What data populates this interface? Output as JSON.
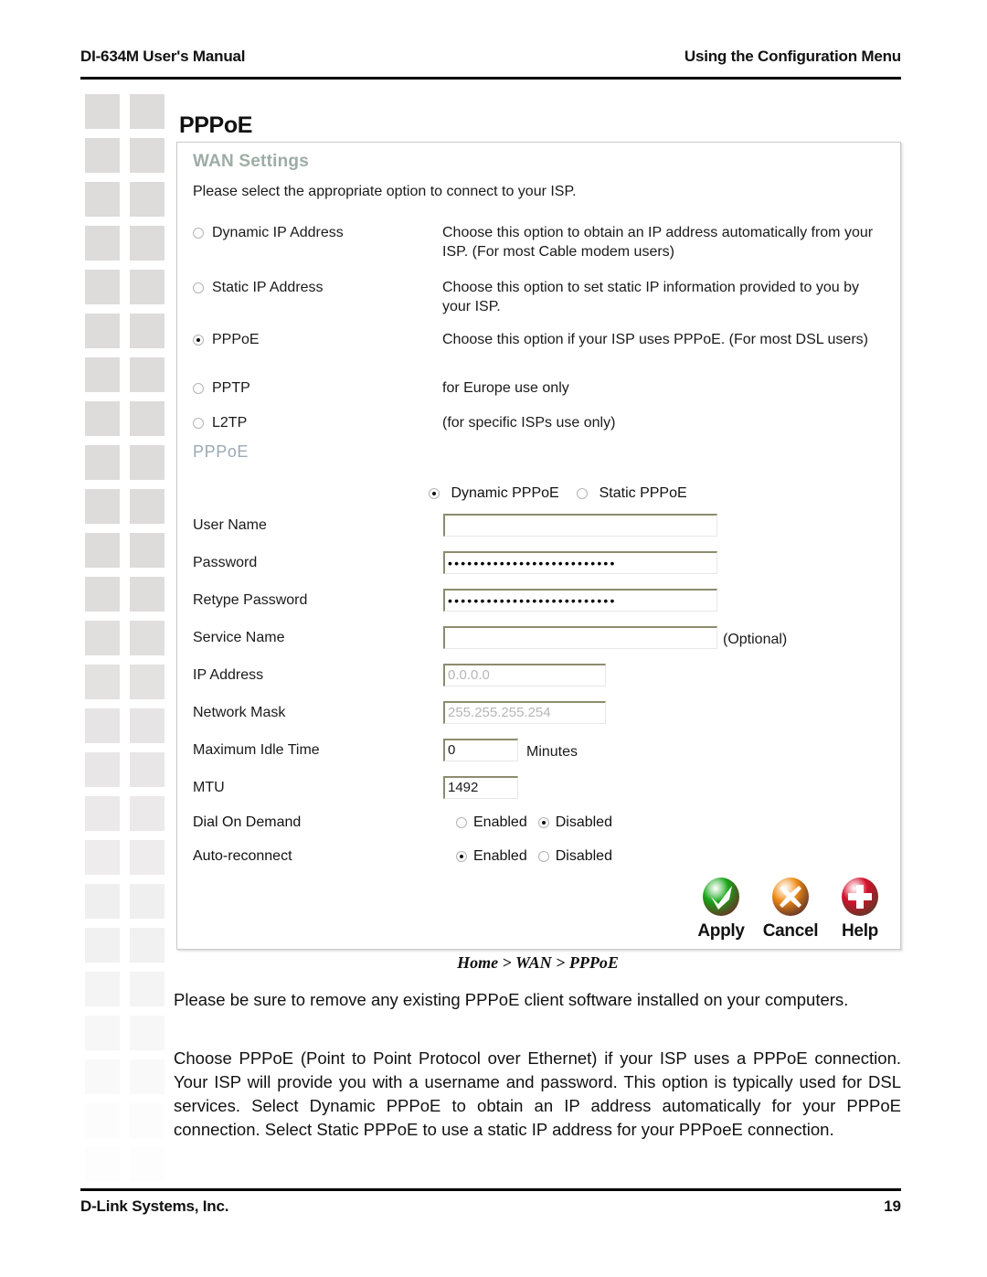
{
  "header": {
    "left": "DI-634M User's Manual",
    "right": "Using the Configuration Menu"
  },
  "section_title": "PPPoE",
  "panel": {
    "wan_heading": "WAN Settings",
    "intro": "Please select the appropriate option to connect to your ISP.",
    "connection_types": [
      {
        "label": "Dynamic IP Address",
        "selected": false,
        "description": "Choose this option to obtain an IP address automatically from your ISP. (For most Cable modem users)"
      },
      {
        "label": "Static IP Address",
        "selected": false,
        "description": "Choose this option to set static IP information provided to you by your ISP."
      },
      {
        "label": "PPPoE",
        "selected": true,
        "description": "Choose this option if your ISP uses PPPoE. (For most DSL users)"
      },
      {
        "label": "PPTP",
        "selected": false,
        "description": "for Europe use only"
      },
      {
        "label": "L2TP",
        "selected": false,
        "description": "(for specific ISPs use only)"
      }
    ],
    "pppoe_heading": "PPPoE",
    "pppoe_mode": {
      "dynamic_label": "Dynamic PPPoE",
      "dynamic_selected": true,
      "static_label": "Static PPPoE",
      "static_selected": false
    },
    "fields": [
      {
        "label": "User Name",
        "value": "",
        "placeholder": ""
      },
      {
        "label": "Password",
        "value": "••••••••••••••••••••••••••",
        "placeholder": ""
      },
      {
        "label": "Retype Password",
        "value": "••••••••••••••••••••••••••",
        "placeholder": ""
      },
      {
        "label": "Service Name",
        "value": "",
        "suffix": "(Optional)"
      },
      {
        "label": "IP Address",
        "value": "0.0.0.0",
        "muted": true
      },
      {
        "label": "Network Mask",
        "value": "255.255.255.254",
        "muted": true
      },
      {
        "label": "Maximum Idle Time",
        "value": "0",
        "suffix": "Minutes"
      },
      {
        "label": "MTU",
        "value": "1492"
      }
    ],
    "toggles": [
      {
        "label": "Dial On Demand",
        "enabled_label": "Enabled",
        "disabled_label": "Disabled",
        "selected": "Disabled"
      },
      {
        "label": "Auto-reconnect",
        "enabled_label": "Enabled",
        "disabled_label": "Disabled",
        "selected": "Enabled"
      }
    ],
    "actions": [
      {
        "icon": "check-circle-icon",
        "label": "Apply",
        "color": "#18a618"
      },
      {
        "icon": "x-circle-icon",
        "label": "Cancel",
        "color": "#f08c18"
      },
      {
        "icon": "plus-circle-icon",
        "label": "Help",
        "color": "#d5112c"
      }
    ]
  },
  "caption": "Home > WAN > PPPoE",
  "paragraphs": {
    "p1": "Please be sure to remove any existing PPPoE client software installed on your computers.",
    "p2": "Choose PPPoE (Point to Point Protocol over Ethernet) if your ISP uses a PPPoE connection. Your ISP will provide you with a username and password. This option is typically used for DSL services. Select Dynamic PPPoE to obtain an IP address automatically for your PPPoE connection. Select Static PPPoE to use a static IP address for your PPPoeE connection."
  },
  "footer": {
    "left": "D-Link Systems, Inc.",
    "right": "19"
  },
  "colors": {
    "heading_sage": "#9dada6",
    "heading_blue": "#9aaab5",
    "deco_square": "#dedbdb"
  }
}
